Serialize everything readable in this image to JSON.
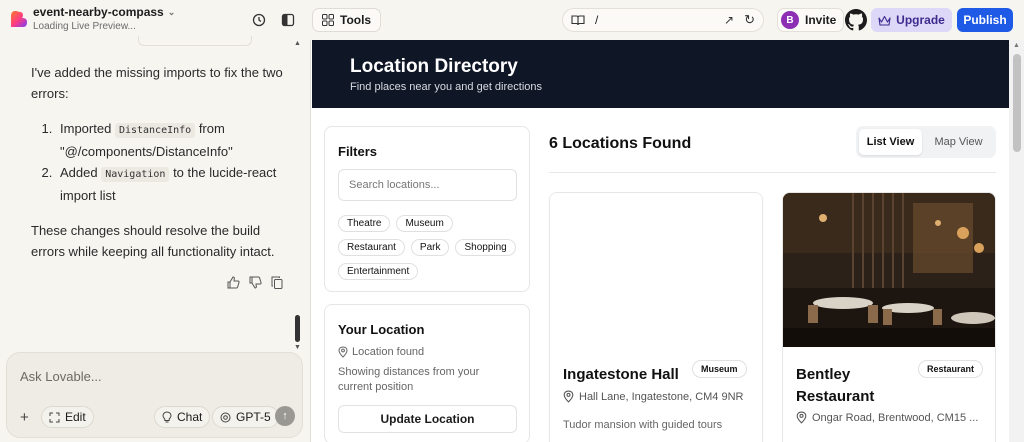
{
  "header": {
    "project_name": "event-nearby-compass",
    "project_status": "Loading Live Preview...",
    "tools_label": "Tools",
    "url_path": "/",
    "invite_label": "Invite",
    "avatar_initial": "B",
    "upgrade_label": "Upgrade",
    "publish_label": "Publish"
  },
  "chat": {
    "intro": "I've added the missing imports to fix the two errors:",
    "item1_pre": "Imported",
    "item1_code": "DistanceInfo",
    "item1_post": "from \"@/components/DistanceInfo\"",
    "item2_pre": "Added",
    "item2_code": "Navigation",
    "item2_post": "to the lucide-react import list",
    "conclusion": "These changes should resolve the build errors while keeping all functionality intact.",
    "composer_placeholder": "Ask Lovable...",
    "edit_label": "Edit",
    "chat_label": "Chat",
    "model_label": "GPT-5"
  },
  "preview": {
    "hero_title": "Location Directory",
    "hero_subtitle": "Find places near you and get directions",
    "filters_title": "Filters",
    "search_placeholder": "Search locations...",
    "categories": [
      "Theatre",
      "Museum",
      "Restaurant",
      "Park",
      "Shopping",
      "Entertainment"
    ],
    "your_location_title": "Your Location",
    "location_status": "Location found",
    "location_desc": "Showing distances from your current position",
    "update_button": "Update Location",
    "results_count": "6 Locations Found",
    "list_view": "List View",
    "map_view": "Map View",
    "cards": [
      {
        "title": "Ingatestone Hall",
        "category": "Museum",
        "address": "Hall Lane, Ingatestone, CM4 9NR",
        "description": "Tudor mansion with guided tours"
      },
      {
        "title": "Bentley Restaurant",
        "category": "Restaurant",
        "address": "Ongar Road, Brentwood, CM15 ..."
      }
    ]
  },
  "colors": {
    "publish": "#1f5ae6",
    "upgrade": "#ddd7f8",
    "hero": "#0f1625",
    "avatar": "#8c2fb5"
  }
}
